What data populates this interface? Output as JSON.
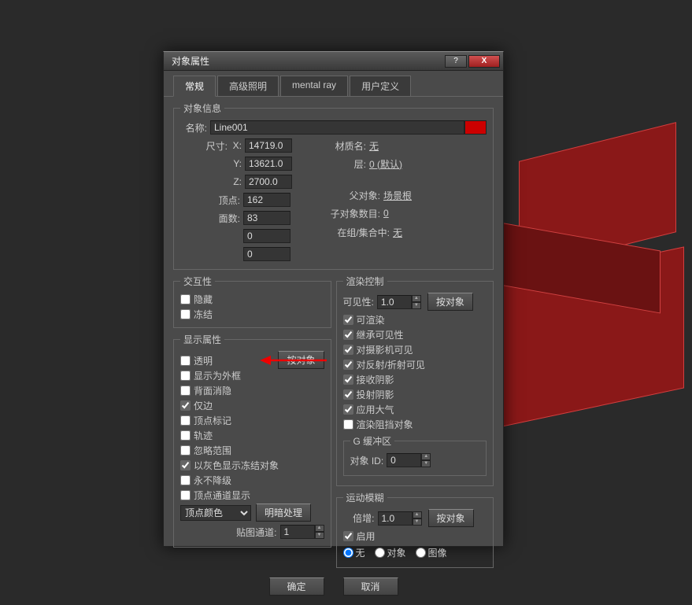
{
  "window": {
    "title": "对象属性"
  },
  "tabs": [
    "常规",
    "高级照明",
    "mental ray",
    "用户定义"
  ],
  "objectInfo": {
    "legend": "对象信息",
    "name_label": "名称:",
    "name": "Line001",
    "size_label": "尺寸:",
    "x_label": "X:",
    "x": "14719.0",
    "y_label": "Y:",
    "y": "13621.0",
    "z_label": "Z:",
    "z": "2700.0",
    "verts_label": "顶点:",
    "verts": "162",
    "faces_label": "面数:",
    "faces": "83",
    "zero": "0",
    "matname_label": "材质名:",
    "matname": "无",
    "layer_label": "层:",
    "layer": "0 (默认)",
    "parent_label": "父对象:",
    "parent": "场景根",
    "numchild_label": "子对象数目:",
    "numchild": "0",
    "ingroup_label": "在组/集合中:",
    "ingroup": "无"
  },
  "interactivity": {
    "legend": "交互性",
    "hide": "隐藏",
    "freeze": "冻结"
  },
  "displayProps": {
    "legend": "显示属性",
    "byobject": "按对象",
    "seethrough": "透明",
    "wireframe": "显示为外框",
    "backface": "背面消隐",
    "edgesonly": "仅边",
    "vertexticks": "顶点标记",
    "trajectory": "轨迹",
    "ignoreextent": "忽略范围",
    "showfrozengray": "以灰色显示冻结对象",
    "neverdegrade": "永不降级",
    "vertexchannel": "顶点通道显示",
    "vertexcolor": "顶点颜色",
    "shaded": "明暗处理",
    "mapchannel_label": "贴图通道:",
    "mapchannel": "1"
  },
  "renderControl": {
    "legend": "渲染控制",
    "visibility_label": "可见性:",
    "visibility": "1.0",
    "byobject": "按对象",
    "renderable": "可渲染",
    "inheritvis": "继承可见性",
    "visibletocamera": "对摄影机可见",
    "visibletorefl": "对反射/折射可见",
    "receiveshadows": "接收阴影",
    "castshadows": "投射阴影",
    "applyatmos": "应用大气",
    "renderoccluded": "渲染阻挡对象"
  },
  "gbuffer": {
    "legend": "G 缓冲区",
    "objectid_label": "对象 ID:",
    "objectid": "0"
  },
  "motionblur": {
    "legend": "运动模糊",
    "multiplier_label": "倍增:",
    "multiplier": "1.0",
    "byobject": "按对象",
    "enabled": "启用",
    "none": "无",
    "object": "对象",
    "image": "图像"
  },
  "footer": {
    "ok": "确定",
    "cancel": "取消"
  }
}
